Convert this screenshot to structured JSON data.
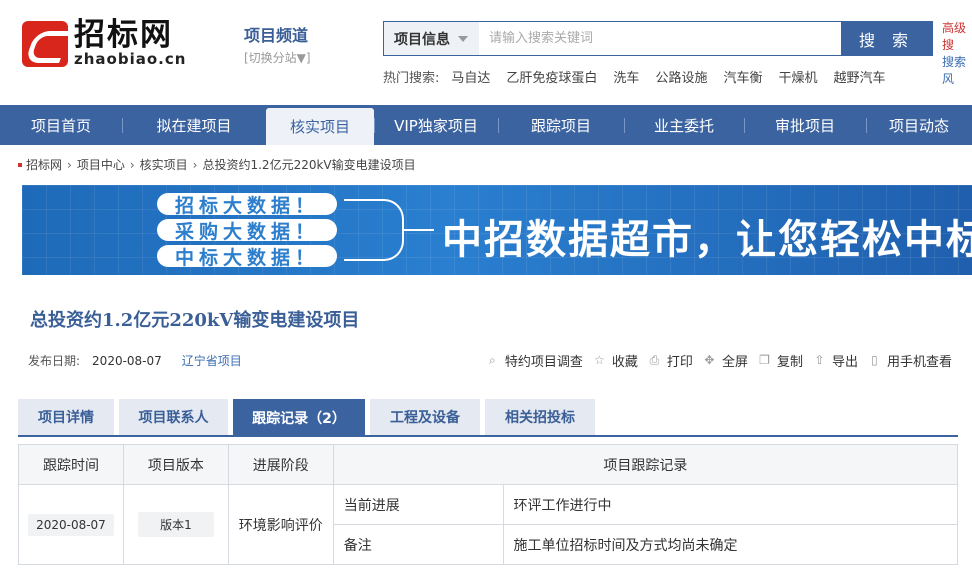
{
  "logo": {
    "cn": "招标网",
    "en": "zhaobiao.cn"
  },
  "channel": {
    "title": "项目频道",
    "switch": "[切换分站▼]"
  },
  "search": {
    "category": "项目信息",
    "placeholder": "请输入搜索关键词",
    "button": "搜 索",
    "advanced": "高级搜",
    "advanced_sub": "搜索风"
  },
  "hot": {
    "label": "热门搜索:",
    "items": [
      "马自达",
      "乙肝免疫球蛋白",
      "洗车",
      "公路设施",
      "汽车衡",
      "干燥机",
      "越野汽车"
    ]
  },
  "nav": {
    "items": [
      "项目首页",
      "拟在建项目",
      "核实项目",
      "VIP独家项目",
      "跟踪项目",
      "业主委托",
      "审批项目",
      "项目动态"
    ],
    "active_index": 2
  },
  "breadcrumb": [
    "招标网",
    "项目中心",
    "核实项目",
    "总投资约1.2亿元220kV输变电建设项目"
  ],
  "banner": {
    "pills": [
      "招标大数据！",
      "采购大数据！",
      "中标大数据！"
    ],
    "slogan": "中招数据超市，让您轻松中标"
  },
  "project": {
    "title": "总投资约1.2亿元220kV输变电建设项目",
    "date_label": "发布日期:",
    "date": "2020-08-07",
    "province": "辽宁省项目"
  },
  "tools": [
    {
      "icon": "search-icon",
      "label": "特约项目调查"
    },
    {
      "icon": "star-icon",
      "label": "收藏"
    },
    {
      "icon": "print-icon",
      "label": "打印"
    },
    {
      "icon": "fullscreen-icon",
      "label": "全屏"
    },
    {
      "icon": "copy-icon",
      "label": "复制"
    },
    {
      "icon": "export-icon",
      "label": "导出"
    },
    {
      "icon": "phone-icon",
      "label": "用手机查看"
    }
  ],
  "tabs": [
    "项目详情",
    "项目联系人",
    "跟踪记录（2）",
    "工程及设备",
    "相关招投标"
  ],
  "table": {
    "headers": [
      "跟踪时间",
      "项目版本",
      "进展阶段",
      "项目跟踪记录"
    ],
    "row": {
      "time": "2020-08-07",
      "version": "版本1",
      "stage": "环境影响评价",
      "records": [
        {
          "label": "当前进展",
          "value": "环评工作进行中"
        },
        {
          "label": "备注",
          "value": "施工单位招标时间及方式均尚未确定"
        }
      ]
    }
  }
}
